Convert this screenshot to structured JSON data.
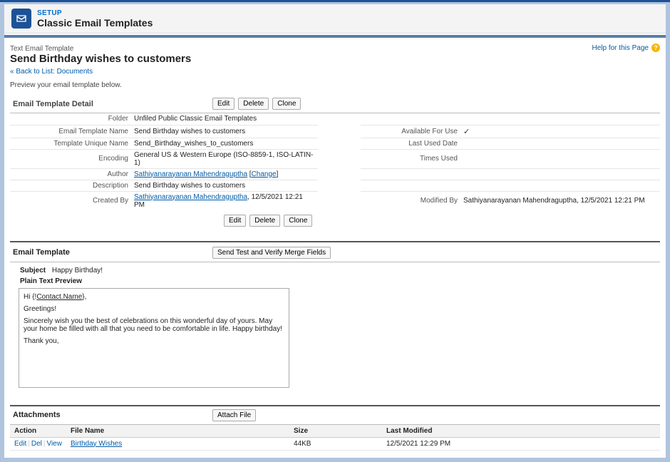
{
  "header": {
    "setup_label": "SETUP",
    "title": "Classic Email Templates"
  },
  "help_link": "Help for this Page",
  "record_type_label": "Text Email Template",
  "page_title": "Send Birthday wishes to customers",
  "back_link_prefix": "« Back to List: ",
  "back_link_text": "Documents",
  "preview_msg": "Preview your email template below.",
  "detail": {
    "section_title": "Email Template Detail",
    "buttons": {
      "edit": "Edit",
      "delete": "Delete",
      "clone": "Clone"
    },
    "labels": {
      "folder": "Folder",
      "template_name": "Email Template Name",
      "unique_name": "Template Unique Name",
      "encoding": "Encoding",
      "author": "Author",
      "description": "Description",
      "created_by": "Created By",
      "available": "Available For Use",
      "last_used": "Last Used Date",
      "times_used": "Times Used",
      "modified_by": "Modified By"
    },
    "values": {
      "folder": "Unfiled Public Classic Email Templates",
      "template_name": "Send Birthday wishes to customers",
      "unique_name": "Send_Birthday_wishes_to_customers",
      "encoding": "General US & Western Europe (ISO-8859-1, ISO-LATIN-1)",
      "author_name": "Sathiyanarayanan Mahendraguptha",
      "author_change": "Change",
      "description": "Send Birthday wishes to customers",
      "created_by_name": "Sathiyanarayanan Mahendraguptha",
      "created_by_date": ", 12/5/2021 12:21 PM",
      "available_check": "✓",
      "modified_by_name": "Sathiyanarayanan Mahendraguptha",
      "modified_by_date": ", 12/5/2021 12:21 PM"
    }
  },
  "template": {
    "section_title": "Email Template",
    "send_test_btn": "Send Test and Verify Merge Fields",
    "subject_label": "Subject",
    "subject_value": "Happy Birthday!",
    "preview_header": "Plain Text Preview",
    "body_line1_pre": "Hi {!",
    "body_line1_merge": "Contact.Name",
    "body_line1_post": "},",
    "body_line2": "Greetings!",
    "body_line3": "Sincerely wish you the best of celebrations on this wonderful day of yours. May your home be filled with all that you need to be comfortable in life. Happy birthday!",
    "body_line4": "Thank you,"
  },
  "attachments": {
    "section_title": "Attachments",
    "attach_btn": "Attach File",
    "columns": {
      "action": "Action",
      "filename": "File Name",
      "size": "Size",
      "last_modified": "Last Modified"
    },
    "actions": {
      "edit": "Edit",
      "del": "Del",
      "view": "View"
    },
    "rows": [
      {
        "filename": "Birthday Wishes",
        "size": "44KB",
        "last_modified": "12/5/2021 12:29 PM"
      }
    ]
  }
}
